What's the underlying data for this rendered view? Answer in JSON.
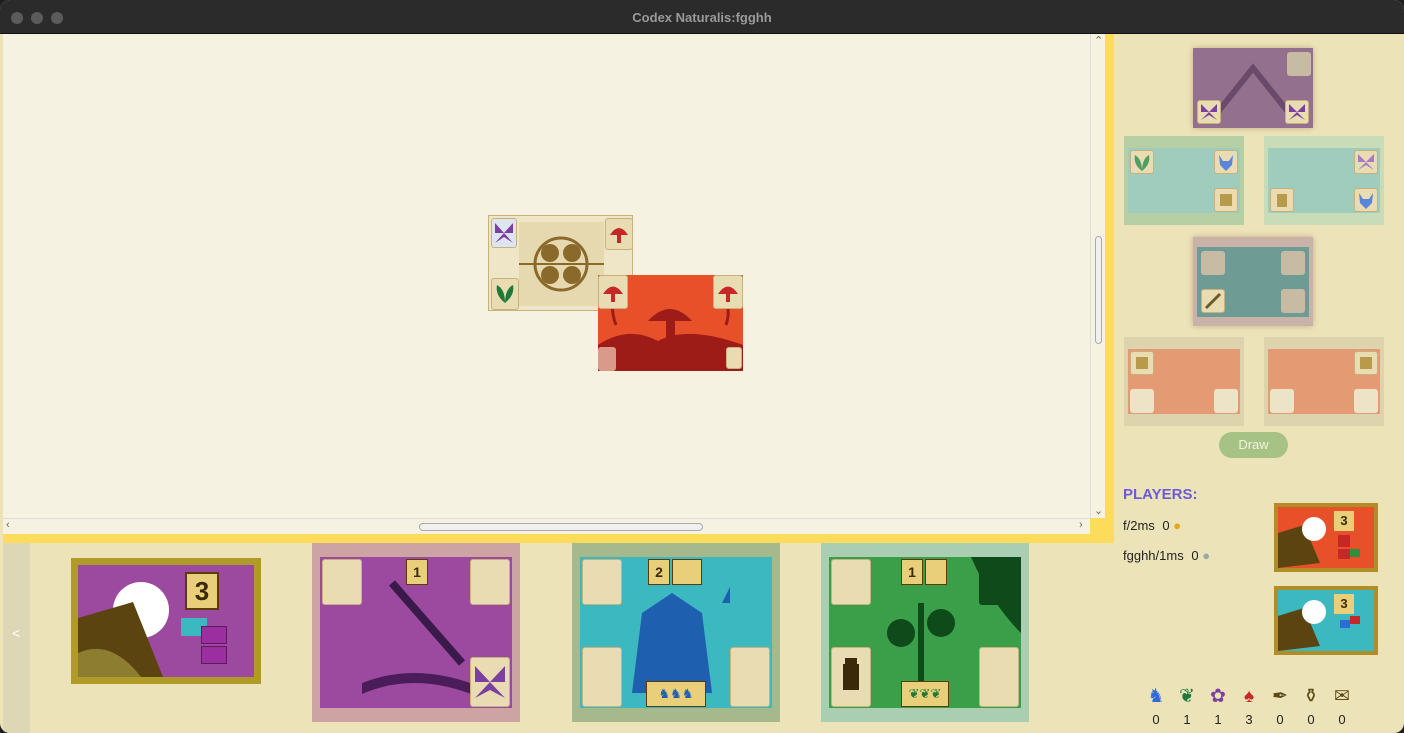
{
  "window": {
    "title": "Codex Naturalis:fgghh"
  },
  "board": {
    "cards": [
      {
        "name": "starter-card",
        "color": "#efe6c7",
        "accent": "#8a6a2a",
        "corners": [
          "butterfly-icon",
          "mushroom-icon",
          "leaf-icon",
          "mushroom-icon"
        ]
      },
      {
        "name": "red-card",
        "color": "#e8502a",
        "accent": "#9d1c18",
        "corners": [
          "",
          "mushroom-icon",
          "",
          ""
        ]
      }
    ]
  },
  "deck": {
    "draw_label": "Draw",
    "rows": [
      {
        "kind": "purple",
        "color": "#94708f"
      },
      {
        "kind": "teal",
        "color": "#a0ccbe"
      },
      {
        "kind": "teal",
        "color": "#a0ccbe"
      },
      {
        "kind": "teal-back",
        "color": "#6e9b94"
      },
      {
        "kind": "red",
        "color": "#e49a72"
      },
      {
        "kind": "red",
        "color": "#e49a72"
      }
    ]
  },
  "players": {
    "title": "PLAYERS:",
    "list": [
      {
        "label": "f/2ms",
        "score": "0",
        "medal": "gold-medal-icon"
      },
      {
        "label": "fgghh/1ms",
        "score": "0",
        "medal": "silver-medal-icon"
      }
    ]
  },
  "hand": {
    "nav_label": "<",
    "objective": {
      "points": "3"
    },
    "cards": [
      {
        "points": "1",
        "color": "#9c4a9f"
      },
      {
        "points": "2",
        "color": "#3bb8c0"
      },
      {
        "points": "1",
        "color": "#3b9f4a"
      }
    ]
  },
  "resources": [
    {
      "icon": "wolf-icon",
      "glyph": "♞",
      "color": "#2e6bd6",
      "count": "0"
    },
    {
      "icon": "leaf-icon",
      "glyph": "❦",
      "color": "#1f7a3a",
      "count": "1"
    },
    {
      "icon": "butterfly-icon",
      "glyph": "✿",
      "color": "#7b3fa0",
      "count": "1"
    },
    {
      "icon": "mushroom-icon",
      "glyph": "♠",
      "color": "#c62828",
      "count": "3"
    },
    {
      "icon": "quill-icon",
      "glyph": "✒",
      "color": "#5a4a1a",
      "count": "0"
    },
    {
      "icon": "inkwell-icon",
      "glyph": "⚱",
      "color": "#5a4a1a",
      "count": "0"
    },
    {
      "icon": "scroll-icon",
      "glyph": "✉",
      "color": "#5a4a1a",
      "count": "0"
    }
  ]
}
